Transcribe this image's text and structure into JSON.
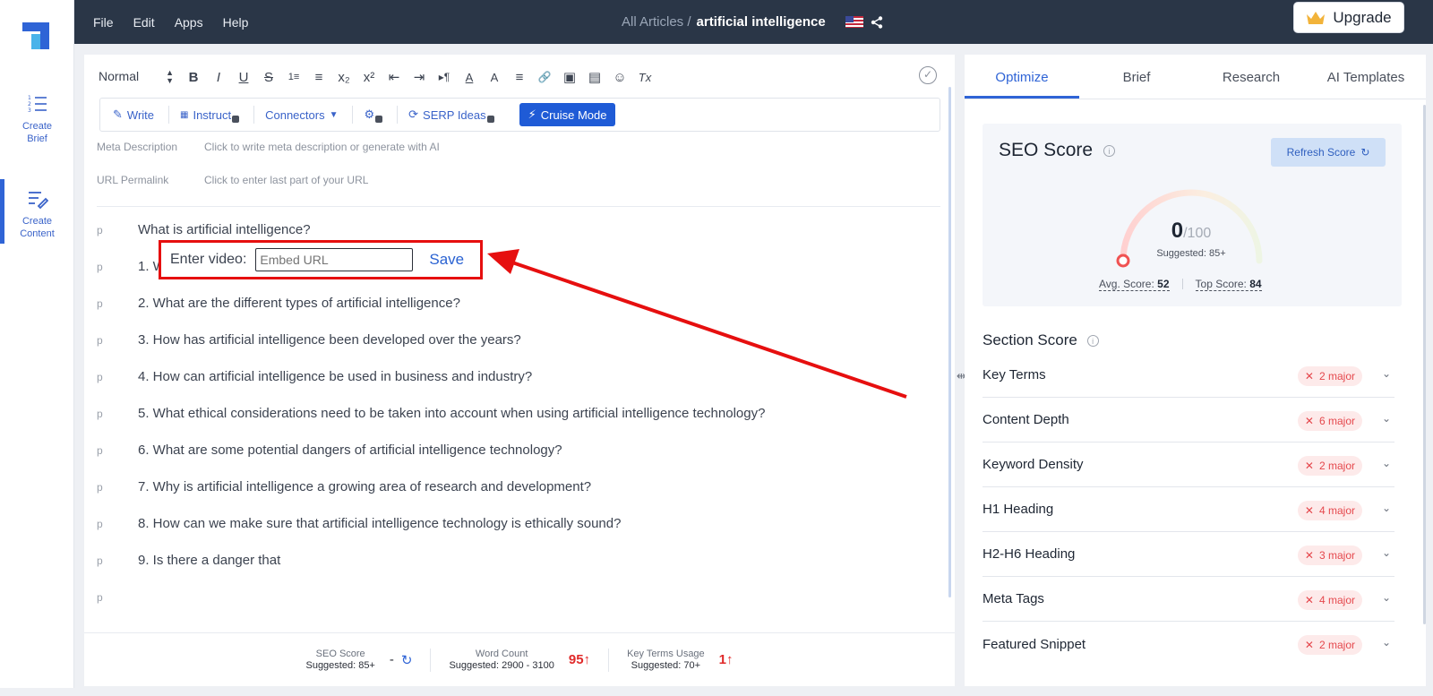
{
  "sidebar": {
    "items": [
      {
        "label": "Create Brief",
        "icon": "list-numbered-icon"
      },
      {
        "label": "Create Content",
        "icon": "write-icon",
        "active": true
      }
    ]
  },
  "topbar": {
    "menu": [
      "File",
      "Edit",
      "Apps",
      "Help"
    ],
    "breadcrumb_root": "All Articles /",
    "breadcrumb_current": "artificial intelligence",
    "upgrade_label": "Upgrade"
  },
  "toolbar": {
    "style_select": "Normal",
    "buttons": [
      "B",
      "I",
      "U",
      "S",
      "1≡",
      "≡",
      "x₂",
      "x²",
      "⇤",
      "⇥",
      "▸¶",
      "A",
      "A",
      "≡",
      "🔗",
      "▣",
      "▤",
      "☺",
      "Tx"
    ]
  },
  "actionbar": {
    "write": "Write",
    "instruct": "Instruct",
    "connectors": "Connectors",
    "serp": "SERP Ideas",
    "cruise": "Cruise Mode"
  },
  "meta": {
    "description_label": "Meta Description",
    "description_value": "Click to write meta description or generate with AI",
    "permalink_label": "URL Permalink",
    "permalink_value": "Click to enter last part of your URL"
  },
  "paragraphs": [
    {
      "tag": "p",
      "text": "What is artificial intelligence?"
    },
    {
      "tag": "p",
      "text": "1. W"
    },
    {
      "tag": "p",
      "text": "2. What are the different types of artificial intelligence?"
    },
    {
      "tag": "p",
      "text": "3. How has artificial intelligence been developed over the years?"
    },
    {
      "tag": "p",
      "text": "4. How can artificial intelligence be used in business and industry?"
    },
    {
      "tag": "p",
      "text": "5. What ethical considerations need to be taken into account when using artificial intelligence technology?"
    },
    {
      "tag": "p",
      "text": "6. What are some potential dangers of artificial intelligence technology?"
    },
    {
      "tag": "p",
      "text": "7. Why is artificial intelligence a growing area of research and development?"
    },
    {
      "tag": "p",
      "text": "8. How can we make sure that artificial intelligence technology is ethically sound?"
    },
    {
      "tag": "p",
      "text": "9. Is there a danger that"
    },
    {
      "tag": "p",
      "text": ""
    }
  ],
  "video_popup": {
    "label": "Enter video:",
    "placeholder": "Embed URL",
    "save": "Save"
  },
  "footer": {
    "seo_label": "SEO Score",
    "seo_sugg": "Suggested: 85+",
    "seo_value": "-",
    "wc_label": "Word Count",
    "wc_sugg": "Suggested: 2900 - 3100",
    "wc_value": "95↑",
    "kt_label": "Key Terms Usage",
    "kt_sugg": "Suggested: 70+",
    "kt_value": "1↑"
  },
  "rpanel": {
    "tabs": [
      "Optimize",
      "Brief",
      "Research",
      "AI Templates"
    ],
    "seo_title": "SEO Score",
    "refresh": "Refresh Score",
    "score": "0",
    "score_max": "/100",
    "score_sugg": "Suggested: 85+",
    "avg_label": "Avg. Score:",
    "avg_value": "52",
    "top_label": "Top Score:",
    "top_value": "84",
    "section_title": "Section Score",
    "sections": [
      {
        "name": "Key Terms",
        "badge": "2 major"
      },
      {
        "name": "Content Depth",
        "badge": "6 major"
      },
      {
        "name": "Keyword Density",
        "badge": "2 major"
      },
      {
        "name": "H1 Heading",
        "badge": "4 major"
      },
      {
        "name": "H2-H6 Heading",
        "badge": "3 major"
      },
      {
        "name": "Meta Tags",
        "badge": "4 major"
      },
      {
        "name": "Featured Snippet",
        "badge": "2 major"
      }
    ]
  },
  "colors": {
    "accent": "#2f64d6",
    "topbar": "#2a3647",
    "annotation": "#e60f0f"
  }
}
